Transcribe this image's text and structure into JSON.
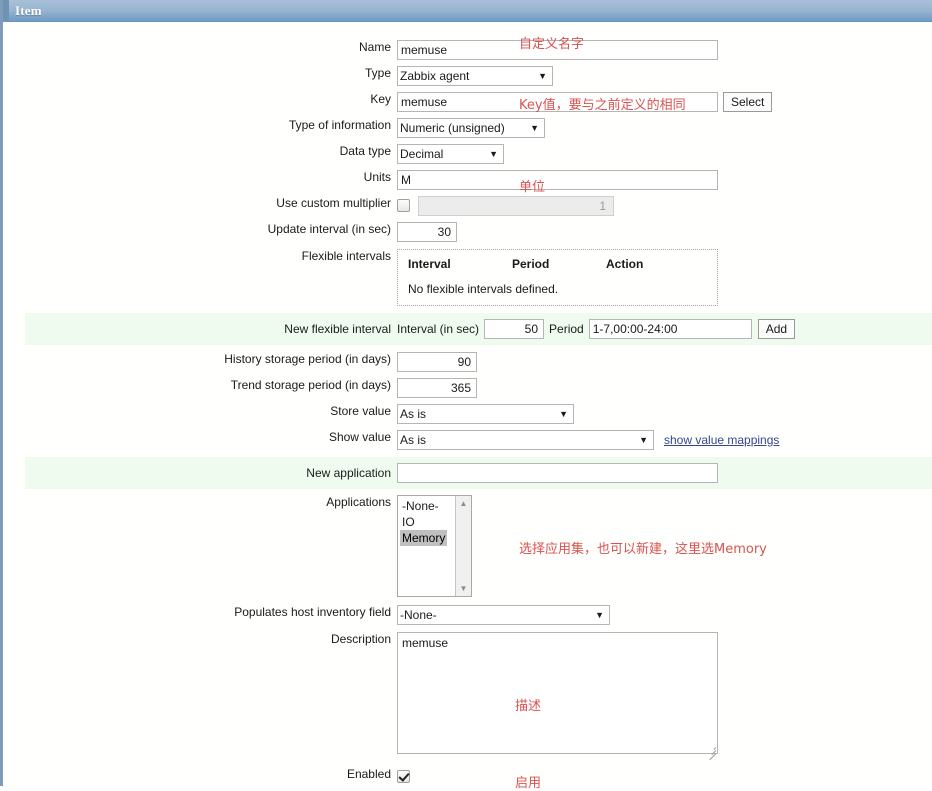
{
  "window": {
    "title": "Item"
  },
  "form": {
    "name": {
      "label": "Name",
      "value": "memuse",
      "note": "自定义名字"
    },
    "type": {
      "label": "Type",
      "value": "Zabbix agent"
    },
    "key": {
      "label": "Key",
      "value": "memuse",
      "note": "Key值，要与之前定义的相同",
      "select_button": "Select"
    },
    "type_of_information": {
      "label": "Type of information",
      "value": "Numeric (unsigned)"
    },
    "data_type": {
      "label": "Data type",
      "value": "Decimal"
    },
    "units": {
      "label": "Units",
      "value": "M",
      "note": "单位"
    },
    "custom_multiplier": {
      "label": "Use custom multiplier",
      "checked": false,
      "value": "1"
    },
    "update_interval": {
      "label": "Update interval (in sec)",
      "value": "30"
    },
    "flexible_intervals": {
      "label": "Flexible intervals",
      "columns": [
        "Interval",
        "Period",
        "Action"
      ],
      "empty_text": "No flexible intervals defined."
    },
    "new_flexible_interval": {
      "label": "New flexible interval",
      "interval_label": "Interval (in sec)",
      "interval_value": "50",
      "period_label": "Period",
      "period_value": "1-7,00:00-24:00",
      "add_button": "Add"
    },
    "history_storage": {
      "label": "History storage period (in days)",
      "value": "90"
    },
    "trend_storage": {
      "label": "Trend storage period (in days)",
      "value": "365"
    },
    "store_value": {
      "label": "Store value",
      "value": "As is"
    },
    "show_value": {
      "label": "Show value",
      "value": "As is",
      "link": "show value mappings"
    },
    "new_application": {
      "label": "New application",
      "value": "",
      "placeholder": ""
    },
    "applications": {
      "label": "Applications",
      "options": [
        "-None-",
        "IO",
        "Memory"
      ],
      "selected": "Memory",
      "note": "选择应用集，也可以新建，这里选Memory"
    },
    "host_inventory": {
      "label": "Populates host inventory field",
      "value": "-None-"
    },
    "description": {
      "label": "Description",
      "value": "memuse",
      "note": "描述"
    },
    "enabled": {
      "label": "Enabled",
      "checked": true,
      "note": "启用"
    }
  },
  "colors": {
    "title_bar": "#6f9ac4",
    "green_row": "#effbef",
    "note_red": "#d9534f",
    "link_blue": "#33468f"
  }
}
